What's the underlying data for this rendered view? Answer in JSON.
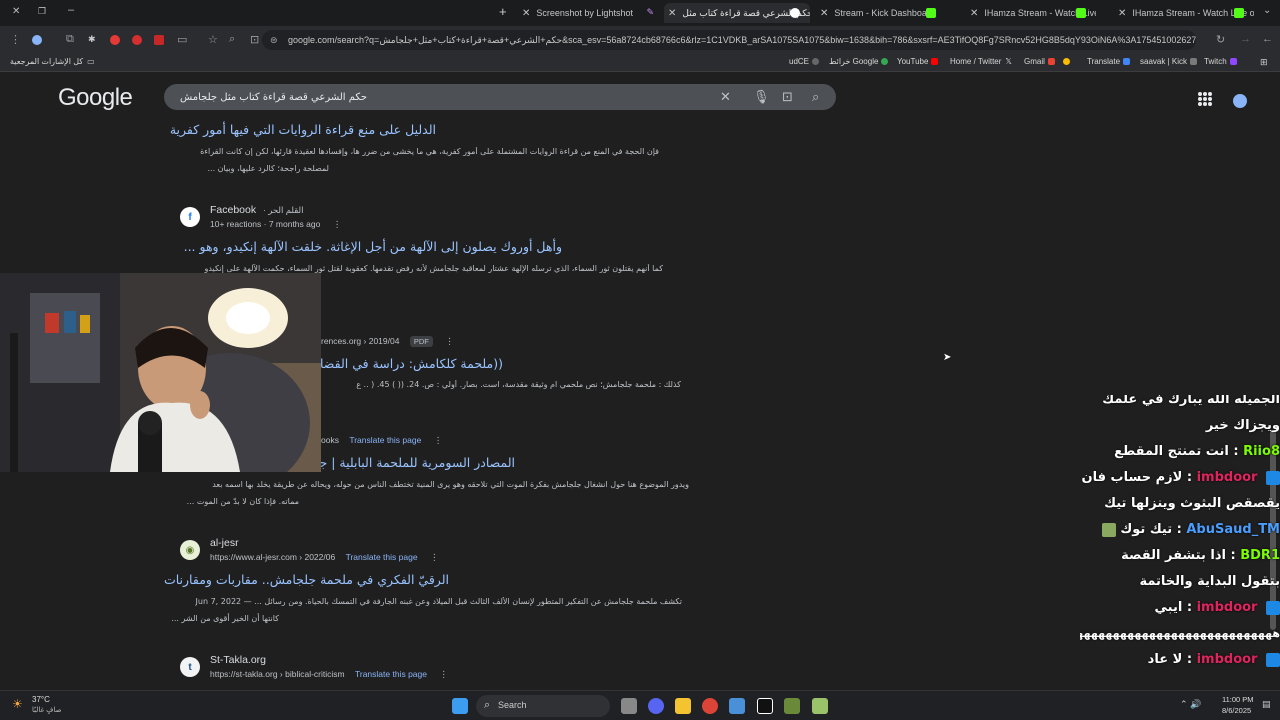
{
  "browser": {
    "tabs": [
      {
        "title": "Screenshot by Lightshot",
        "active": false
      },
      {
        "title": "حكم الشرعي قصة قراءة كتاب مثل",
        "active": true
      },
      {
        "title": "Stream - Kick Dashboard",
        "active": false
      },
      {
        "title": "IHamza Stream - Watch Live on",
        "active": false
      },
      {
        "title": "IHamza Stream - Watch Live on",
        "active": false
      }
    ],
    "new_tab": "+",
    "url": "google.com/search?q=حكم+الشرعي+قصة+قراءة+كتاب+مثل+جلجامش&sca_esv=56a8724cb68766c6&rlz=1C1VDKB_arSA1075SA1075&biw=1638&bih=786&sxsrf=AE3TifOQ8Fg7SRncv52HG8B5dqY93OiN6A%3A1754510026272&ei=...",
    "bookmarks": [
      {
        "label": "كل الإشارات المرجعية"
      },
      {
        "label": "Twitch"
      },
      {
        "label": "saavak | Kick"
      },
      {
        "label": "Translate"
      },
      {
        "label": "Gmail"
      },
      {
        "label": "Home / Twitter"
      },
      {
        "label": "YouTube"
      },
      {
        "label": "خرائط Google"
      },
      {
        "label": "udCE"
      }
    ]
  },
  "google": {
    "logo": "Google",
    "query": "حكم الشرعي قصة قراءة كتاب مثل جلجامش"
  },
  "results": [
    {
      "title": "الدليل على منع قراءة الروايات التي فيها أمور كفرية",
      "snippet1": "فإن الحجة في المنع من قراءة الروايات المشتملة على أمور كفرية، هي ما يخشى من ضرر ها، وإفسادها لعقيدة قارئها، لكن إن كانت القراءة",
      "snippet2": "لمصلحة راجحة؛ كالرد عليها، وبيان ..."
    },
    {
      "site_name": "Facebook",
      "site_extra": "· القلم الحر",
      "meta": "10+ reactions · 7 months ago",
      "title": "وأهل أوروك يصلون إلى الآلهة من أجل الإغاثة. خلقت الآلهة إنكيدو، وهو ...",
      "snippet1": "كما أنهم يقتلون ثور السماء، الذي ترسله الإلهة عشتار لمعاقبة جلجامش لأنه رفض تقدمها. كعقوبة لقتل ثور السماء، حكمت الآلهة على إنكيدو"
    },
    {
      "site_url": "rences.org › 2019/04",
      "pdf": "PDF",
      "title": "((ملحمة كلكامش: دراسة في القضايا",
      "snippet1": "كذلك : ملحمة جلجامش؛ نص ملحمي ام وثيقة مقدسة، است. بصار. أولي : ص. 24. (( ) 45. ( .. ع"
    },
    {
      "site_url": "ooks",
      "translate": "Translate this page",
      "title": "المصادر السومرية للملحمة البابلية | جل",
      "snippet1": "ويدور الموضوع هنا حول انشغال جلجامش بفكرة الموت التي تلاحقه وهو يرى المنية تختطف الناس من حوله، ويحاله عن طريقة يخلّد بها اسمه بعد",
      "snippet2": "مماته. فإذا كان لا بدّ من الموت ..."
    },
    {
      "site_name": "al-jesr",
      "site_url": "https://www.al-jesr.com › 2022/06",
      "translate": "Translate this page",
      "title": "الرقيّ الفكري في ملحمة جلجامش.. مقاربات ومقارنات",
      "snippet1": "تكشف ملحمة جلجامش عن التفكير المتطور لإنسان الألف الثالث قبل الميلاد وعن غبنه الجارفة في التمسك بالحياة. ومن رسائل ... — Jun 7, 2022",
      "snippet2": "كانتها أن الخير أقوى من الشر ..."
    },
    {
      "site_name": "St-Takla.org",
      "site_url": "https://st-takla.org › biblical-criticism",
      "translate": "Translate this page"
    }
  ],
  "chat": [
    {
      "user": "",
      "text": "الجميله الله يبارك في علمك ويجزاك خير",
      "color": "#ffffff"
    },
    {
      "user": "Riio8",
      "text": "انت تمنتج المقطع",
      "color": "#7cfc00"
    },
    {
      "user": "imbdoor",
      "text": "لازم حساب فان يقصقص البثوث وينزلها تيك",
      "color": "#e0245e"
    },
    {
      "user": "AbuSaud_TM",
      "text": "تيك توك",
      "color": "#4a9eff"
    },
    {
      "user": "BDR1",
      "text": "اذا بتشفر القصة بتقول البداية والخاتمة",
      "color": "#7cfc00"
    },
    {
      "user": "imbdoor",
      "text": "ايبي",
      "color": "#e0245e"
    },
    {
      "user": "",
      "text": "ههههههههههههههههههههههههههههههه",
      "color": "#ffffff"
    },
    {
      "user": "imbdoor",
      "text": "لا عاد",
      "color": "#e0245e"
    }
  ],
  "taskbar": {
    "weather_temp": "37°C",
    "weather_desc": "صافٍ غالبًا",
    "search": "Search",
    "time": "11:00 PM",
    "date": "8/6/2025"
  },
  "colors": {
    "link": "#99c3ff",
    "background": "#1f1f1f"
  }
}
